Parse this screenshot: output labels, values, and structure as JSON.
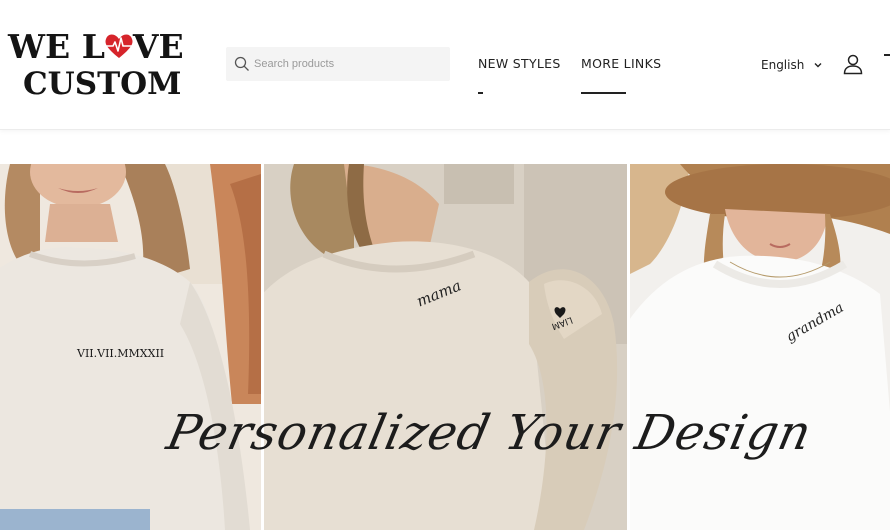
{
  "brand": {
    "logo_line1_a": "WE L",
    "logo_line1_b": "VE",
    "logo_line2": "CUSTOM",
    "heart_color": "#d6242b"
  },
  "search": {
    "placeholder": "Search products"
  },
  "nav": {
    "items": [
      {
        "label": "NEW STYLES"
      },
      {
        "label": "MORE LINKS"
      }
    ]
  },
  "header_right": {
    "language": "English",
    "icons": [
      "chevron-down-icon",
      "user-icon"
    ]
  },
  "banner": {
    "tagline": "Personalized Your Design",
    "panels": [
      {
        "print_text": "VII.VII.MMXXII"
      },
      {
        "print_text": "mama",
        "sleeve_text": "LIAM"
      },
      {
        "print_text": "grandma"
      }
    ]
  }
}
